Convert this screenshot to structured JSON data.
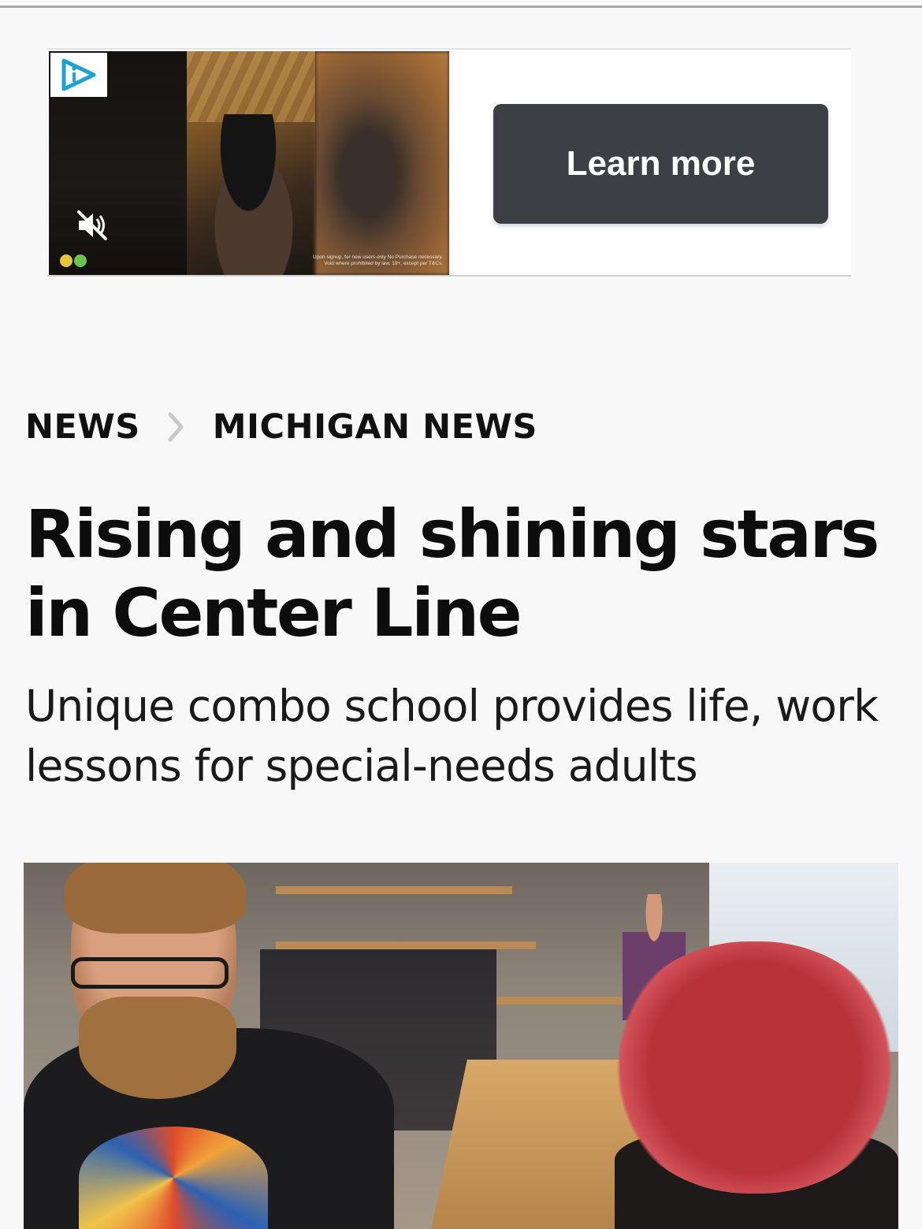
{
  "ad": {
    "cta_label": "Learn more",
    "disclaimer_line1": "Upon signup, for new users only No Purchase necessary.",
    "disclaimer_line2": "Void where prohibited by law. 19+, except per T&Cs."
  },
  "breadcrumb": {
    "items": [
      {
        "label": "NEWS"
      },
      {
        "label": "MICHIGAN NEWS"
      }
    ]
  },
  "article": {
    "headline": "Rising and shining stars in Center Line",
    "subheadline": "Unique combo school provides life, work lessons for special-needs adults"
  },
  "icons": {
    "ad_logo": "play-info-icon",
    "mute": "speaker-muted-icon",
    "separator": "chevron-right-icon"
  },
  "colors": {
    "cta_background": "#3c3f43",
    "ad_logo_accent": "#1fa0d6",
    "separator": "#c8c8c8"
  }
}
